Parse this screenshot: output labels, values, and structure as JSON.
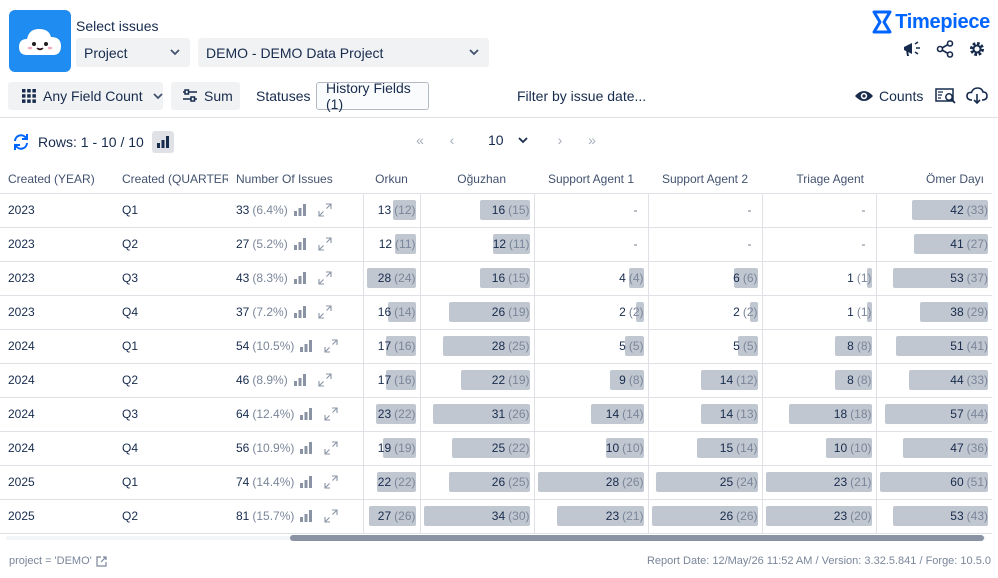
{
  "header": {
    "select_label": "Select issues",
    "scope_dropdown": "Project",
    "project_dropdown": "DEMO - DEMO Data Project",
    "brand": "Timepiece"
  },
  "toolbar": {
    "field_count": "Any Field Count",
    "sum": "Sum",
    "statuses": "Statuses",
    "history_fields": "History Fields (1)",
    "filter_by_date": "Filter by issue date...",
    "counts": "Counts"
  },
  "controls": {
    "rows_label": "Rows: 1 - 10 / 10",
    "page_size": "10"
  },
  "table": {
    "columns": [
      "Created (YEAR)",
      "Created (QUARTER)",
      "Number Of Issues",
      "Orkun",
      "Oğuzhan",
      "Support Agent 1",
      "Support Agent 2",
      "Triage Agent",
      "Ömer Dayı"
    ],
    "rows": [
      {
        "year": "2023",
        "quarter": "Q1",
        "count": "33",
        "pct": "(6.4%)",
        "cells": [
          [
            "13",
            "(12)"
          ],
          [
            "16",
            "(15)"
          ],
          [
            "-",
            ""
          ],
          [
            "-",
            ""
          ],
          [
            "-",
            ""
          ],
          [
            "42",
            "(33)"
          ]
        ]
      },
      {
        "year": "2023",
        "quarter": "Q2",
        "count": "27",
        "pct": "(5.2%)",
        "cells": [
          [
            "12",
            "(11)"
          ],
          [
            "12",
            "(11)"
          ],
          [
            "-",
            ""
          ],
          [
            "-",
            ""
          ],
          [
            "-",
            ""
          ],
          [
            "41",
            "(27)"
          ]
        ]
      },
      {
        "year": "2023",
        "quarter": "Q3",
        "count": "43",
        "pct": "(8.3%)",
        "cells": [
          [
            "28",
            "(24)"
          ],
          [
            "16",
            "(15)"
          ],
          [
            "4",
            "(4)"
          ],
          [
            "6",
            "(6)"
          ],
          [
            "1",
            "(1)"
          ],
          [
            "53",
            "(37)"
          ]
        ]
      },
      {
        "year": "2023",
        "quarter": "Q4",
        "count": "37",
        "pct": "(7.2%)",
        "cells": [
          [
            "16",
            "(14)"
          ],
          [
            "26",
            "(19)"
          ],
          [
            "2",
            "(2)"
          ],
          [
            "2",
            "(2)"
          ],
          [
            "1",
            "(1)"
          ],
          [
            "38",
            "(29)"
          ]
        ]
      },
      {
        "year": "2024",
        "quarter": "Q1",
        "count": "54",
        "pct": "(10.5%)",
        "cells": [
          [
            "17",
            "(16)"
          ],
          [
            "28",
            "(25)"
          ],
          [
            "5",
            "(5)"
          ],
          [
            "5",
            "(5)"
          ],
          [
            "8",
            "(8)"
          ],
          [
            "51",
            "(41)"
          ]
        ]
      },
      {
        "year": "2024",
        "quarter": "Q2",
        "count": "46",
        "pct": "(8.9%)",
        "cells": [
          [
            "17",
            "(16)"
          ],
          [
            "22",
            "(19)"
          ],
          [
            "9",
            "(8)"
          ],
          [
            "14",
            "(12)"
          ],
          [
            "8",
            "(8)"
          ],
          [
            "44",
            "(33)"
          ]
        ]
      },
      {
        "year": "2024",
        "quarter": "Q3",
        "count": "64",
        "pct": "(12.4%)",
        "cells": [
          [
            "23",
            "(22)"
          ],
          [
            "31",
            "(26)"
          ],
          [
            "14",
            "(14)"
          ],
          [
            "14",
            "(13)"
          ],
          [
            "18",
            "(18)"
          ],
          [
            "57",
            "(44)"
          ]
        ]
      },
      {
        "year": "2024",
        "quarter": "Q4",
        "count": "56",
        "pct": "(10.9%)",
        "cells": [
          [
            "19",
            "(19)"
          ],
          [
            "25",
            "(22)"
          ],
          [
            "10",
            "(10)"
          ],
          [
            "15",
            "(14)"
          ],
          [
            "10",
            "(10)"
          ],
          [
            "47",
            "(36)"
          ]
        ]
      },
      {
        "year": "2025",
        "quarter": "Q1",
        "count": "74",
        "pct": "(14.4%)",
        "cells": [
          [
            "22",
            "(22)"
          ],
          [
            "26",
            "(25)"
          ],
          [
            "28",
            "(26)"
          ],
          [
            "25",
            "(24)"
          ],
          [
            "23",
            "(21)"
          ],
          [
            "60",
            "(51)"
          ]
        ]
      },
      {
        "year": "2025",
        "quarter": "Q2",
        "count": "81",
        "pct": "(15.7%)",
        "cells": [
          [
            "27",
            "(26)"
          ],
          [
            "34",
            "(30)"
          ],
          [
            "23",
            "(21)"
          ],
          [
            "26",
            "(26)"
          ],
          [
            "23",
            "(20)"
          ],
          [
            "53",
            "(43)"
          ]
        ]
      }
    ]
  },
  "footer": {
    "jql": "project = 'DEMO'",
    "report_info": "Report Date: 12/May/26 11:52 AM / Version: 3.32.5.841 / Forge: 10.5.0"
  },
  "colors": {
    "accent": "#0065ff",
    "bar": "#c1c7d0",
    "logo_bg": "#1e8cf0"
  },
  "icons": [
    "cloud-logo-icon",
    "chevron-down-icon",
    "timepiece-logo-icon",
    "megaphone-icon",
    "share-icon",
    "gear-icon",
    "grid-icon",
    "sliders-icon",
    "eye-icon",
    "monitor-search-icon",
    "cloud-download-icon",
    "refresh-icon",
    "bar-chart-icon",
    "first-page-icon",
    "prev-page-icon",
    "next-page-icon",
    "last-page-icon",
    "expand-icon",
    "external-link-icon"
  ]
}
